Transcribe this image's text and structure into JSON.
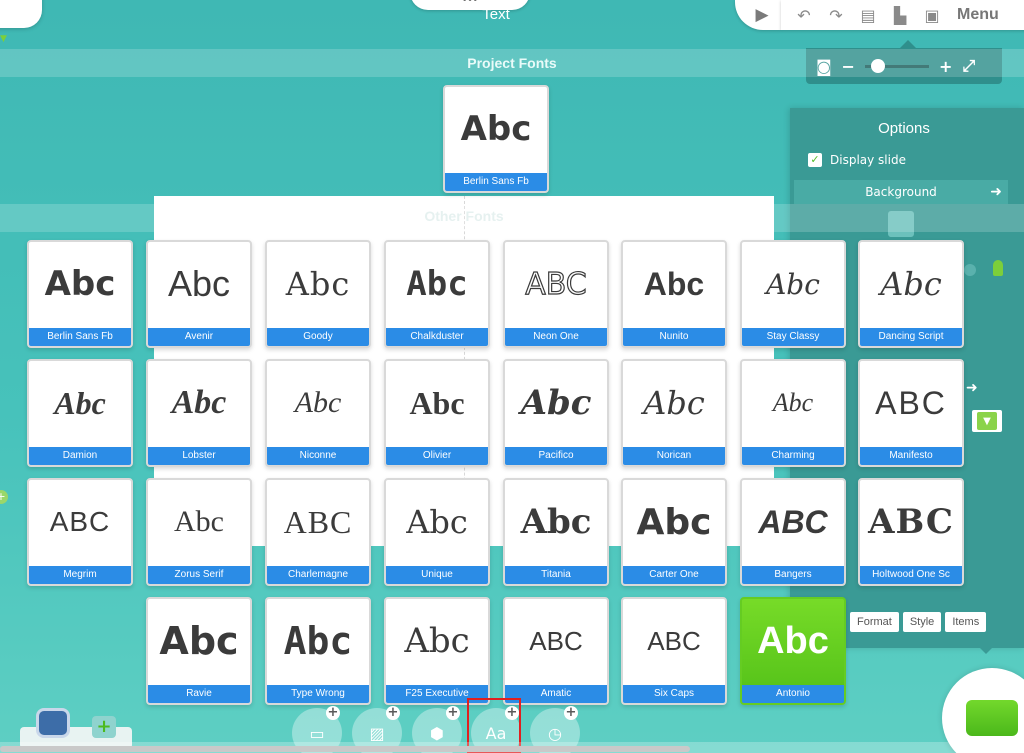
{
  "header": {
    "title": "Text",
    "pull_tab": "•••",
    "menu_label": "Menu",
    "icons": [
      "undo-icon",
      "redo-icon",
      "document-icon",
      "briefcase-icon",
      "save-icon"
    ]
  },
  "zoom": {
    "level": 0.1
  },
  "sections": {
    "project_fonts_title": "Project Fonts",
    "other_fonts_title": "Other Fonts"
  },
  "project_fonts": [
    {
      "name": "Berlin Sans Fb",
      "sample": "Abc"
    }
  ],
  "other_fonts": [
    {
      "name": "Berlin Sans Fb",
      "sample": "Abc"
    },
    {
      "name": "Avenir",
      "sample": "Abc"
    },
    {
      "name": "Goody",
      "sample": "Abc"
    },
    {
      "name": "Chalkduster",
      "sample": "Abc"
    },
    {
      "name": "Neon One",
      "sample": "ABC"
    },
    {
      "name": "Nunito",
      "sample": "Abc"
    },
    {
      "name": "Stay Classy",
      "sample": "Abc"
    },
    {
      "name": "Dancing Script",
      "sample": "Abc"
    },
    {
      "name": "Damion",
      "sample": "Abc"
    },
    {
      "name": "Lobster",
      "sample": "Abc"
    },
    {
      "name": "Niconne",
      "sample": "Abc"
    },
    {
      "name": "Olivier",
      "sample": "Abc"
    },
    {
      "name": "Pacifico",
      "sample": "Abc"
    },
    {
      "name": "Norican",
      "sample": "Abc"
    },
    {
      "name": "Charming",
      "sample": "Abc"
    },
    {
      "name": "Manifesto",
      "sample": "ABC"
    },
    {
      "name": "Megrim",
      "sample": "ABC"
    },
    {
      "name": "Zorus Serif",
      "sample": "Abc"
    },
    {
      "name": "Charlemagne",
      "sample": "ABC"
    },
    {
      "name": "Unique",
      "sample": "Abc"
    },
    {
      "name": "Titania",
      "sample": "Abc"
    },
    {
      "name": "Carter One",
      "sample": "Abc"
    },
    {
      "name": "Bangers",
      "sample": "ABC"
    },
    {
      "name": "Holtwood One Sc",
      "sample": "ABC"
    },
    {
      "name": "Ravie",
      "sample": "Abc"
    },
    {
      "name": "Type Wrong",
      "sample": "Abc"
    },
    {
      "name": "F25 Executive",
      "sample": "Abc"
    },
    {
      "name": "Amatic",
      "sample": "ABC"
    },
    {
      "name": "Six Caps",
      "sample": "ABC"
    },
    {
      "name": "Antonio",
      "sample": "Abc",
      "selected": true
    }
  ],
  "options": {
    "title": "Options",
    "display_slide": "Display slide",
    "background": "Background",
    "tabs": [
      "Format",
      "Style",
      "Items"
    ]
  },
  "insert_bar": [
    "shape-rect-icon",
    "image-icon",
    "hexagon-icon",
    "text-icon",
    "clock-icon"
  ],
  "insert_text_label": "Aa",
  "colors": {
    "accent_blue": "#2b8ce6",
    "accent_green": "#5cc61e",
    "teal": "#3fb8b4"
  }
}
